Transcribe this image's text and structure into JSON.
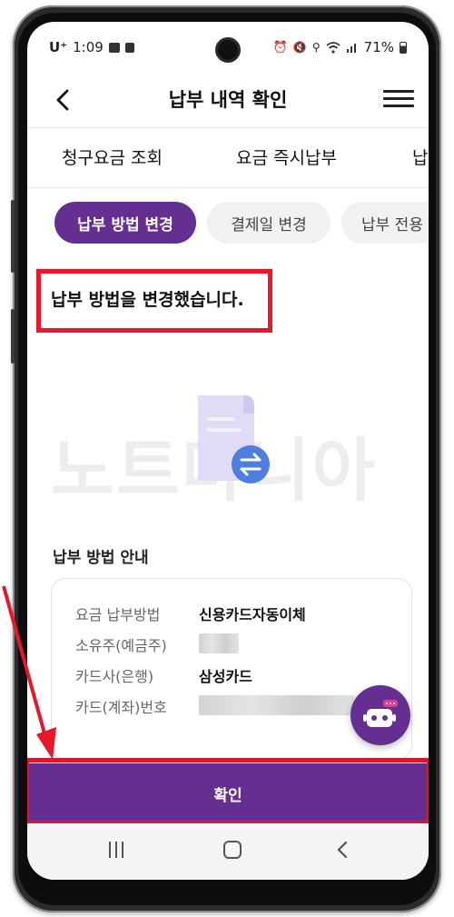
{
  "status_bar": {
    "carrier": "U⁺",
    "time": "1:09",
    "battery": "71%"
  },
  "header": {
    "title": "납부 내역 확인"
  },
  "tabs": [
    {
      "label": "청구요금 조회"
    },
    {
      "label": "요금 즉시납부"
    },
    {
      "label": "납"
    }
  ],
  "chips": [
    {
      "label": "납부 방법 변경",
      "active": true
    },
    {
      "label": "결제일 변경",
      "active": false
    },
    {
      "label": "납부 전용",
      "active": false
    }
  ],
  "message": "납부 방법을 변경했습니다.",
  "watermark": "노트마니아",
  "section": {
    "title": "납부 방법 안내"
  },
  "info": {
    "rows": [
      {
        "label": "요금 납부방법",
        "value": "신용카드자동이체"
      },
      {
        "label": "소유주(예금주)",
        "value": ""
      },
      {
        "label": "카드사(은행)",
        "value": "삼성카드"
      },
      {
        "label": "카드(계좌)번호",
        "value": ""
      }
    ]
  },
  "confirm_button": {
    "label": "확인"
  },
  "colors": {
    "brand_purple": "#652e91",
    "highlight_red": "#e8182a"
  }
}
